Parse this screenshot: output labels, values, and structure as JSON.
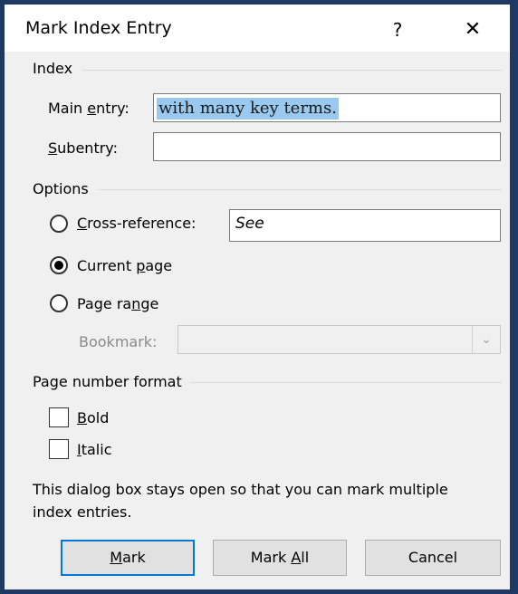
{
  "dialog": {
    "title": "Mark Index Entry",
    "help_glyph": "?",
    "close_glyph": "✕"
  },
  "index_section": {
    "label": "Index",
    "main_entry": {
      "label_pre": "Main ",
      "label_key": "e",
      "label_post": "ntry:",
      "value": "with many key terms."
    },
    "subentry": {
      "label_pre": "",
      "label_key": "S",
      "label_post": "ubentry:",
      "value": ""
    }
  },
  "options_section": {
    "label": "Options",
    "cross_reference": {
      "label_pre": "",
      "label_key": "C",
      "label_post": "ross-reference:",
      "value": "See",
      "checked": false
    },
    "current_page": {
      "label_pre": "Current ",
      "label_key": "p",
      "label_post": "age",
      "checked": true
    },
    "page_range": {
      "label_pre": "Page ra",
      "label_key": "n",
      "label_post": "ge",
      "checked": false
    },
    "bookmark": {
      "label": "Bookmark:",
      "value": "",
      "enabled": false
    }
  },
  "format_section": {
    "label": "Page number format",
    "bold": {
      "label_key": "B",
      "label_post": "old",
      "checked": false
    },
    "italic": {
      "label_key": "I",
      "label_post": "talic",
      "checked": false
    }
  },
  "info": "This dialog box stays open so that you can mark multiple index entries.",
  "buttons": {
    "mark": {
      "label_key": "M",
      "label_post": "ark"
    },
    "mark_all": {
      "label_pre": "Mark ",
      "label_key": "A",
      "label_post": "ll"
    },
    "cancel": {
      "label": "Cancel"
    }
  },
  "colors": {
    "border": "#1f3864",
    "selection": "#99c9ef",
    "default_button_border": "#0078d7"
  }
}
